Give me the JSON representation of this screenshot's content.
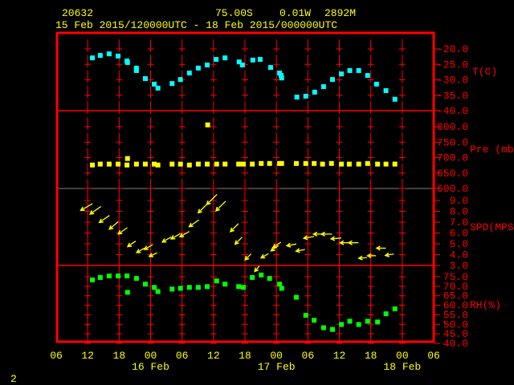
{
  "header": {
    "station": "20632",
    "lat": "75.00S",
    "lon": "0.01W",
    "elev": "2892M",
    "period": "15 Feb 2015/120000UTC - 18 Feb 2015/000000UTC"
  },
  "footer": {
    "page": "2"
  },
  "colors": {
    "frame": "#ff0000",
    "text": "#ffff00",
    "temp": "#00ffff",
    "pres": "#ffff00",
    "wind": "#ffff00",
    "rh": "#00ff00",
    "separator": "#808080"
  },
  "chart_data": {
    "type": "scatter",
    "title": "20632  75.00S  0.01W  2892M",
    "subtitle": "15 Feb 2015/120000UTC - 18 Feb 2015/000000UTC",
    "x_unit": "hours since 15 Feb 2015 06UTC",
    "x_range": [
      0,
      72
    ],
    "x_tick_hours": [
      0,
      6,
      12,
      18,
      24,
      30,
      36,
      42,
      48,
      54,
      60,
      66,
      72
    ],
    "x_tick_labels": [
      "06",
      "12",
      "18",
      "00",
      "06",
      "12",
      "18",
      "00",
      "06",
      "12",
      "18",
      "00",
      "06"
    ],
    "date_labels": [
      {
        "hour": 18,
        "label": "16 Feb"
      },
      {
        "hour": 42,
        "label": "17 Feb"
      },
      {
        "hour": 66,
        "label": "18 Feb"
      }
    ],
    "panels": [
      {
        "name": "T(C)",
        "ylim": [
          -40,
          -20
        ],
        "ticks": [
          -20,
          -25,
          -30,
          -35,
          -40
        ],
        "tick_labels": [
          "-20.0",
          "-25.0",
          "-30.0",
          "-35.0",
          "-40.0"
        ],
        "series_color": "#00ffff",
        "points": [
          [
            6.9,
            -22.9
          ],
          [
            8.4,
            -22.1
          ],
          [
            10.1,
            -21.6
          ],
          [
            11.8,
            -22.3
          ],
          [
            13.5,
            -23.9
          ],
          [
            13.6,
            -24.4
          ],
          [
            15.3,
            -26.2
          ],
          [
            15.3,
            -27.0
          ],
          [
            17.0,
            -29.6
          ],
          [
            18.7,
            -31.4
          ],
          [
            19.4,
            -32.7
          ],
          [
            22.1,
            -31.2
          ],
          [
            23.7,
            -29.9
          ],
          [
            25.4,
            -27.8
          ],
          [
            27.1,
            -26.2
          ],
          [
            28.8,
            -25.2
          ],
          [
            30.5,
            -23.4
          ],
          [
            32.2,
            -22.9
          ],
          [
            34.9,
            -24.2
          ],
          [
            35.5,
            -25.2
          ],
          [
            37.5,
            -23.6
          ],
          [
            38.9,
            -23.4
          ],
          [
            40.9,
            -26.0
          ],
          [
            42.6,
            -27.8
          ],
          [
            42.9,
            -28.6
          ],
          [
            43.0,
            -29.4
          ],
          [
            45.9,
            -35.6
          ],
          [
            47.6,
            -35.3
          ],
          [
            49.3,
            -34.0
          ],
          [
            51.0,
            -32.2
          ],
          [
            52.7,
            -29.9
          ],
          [
            54.4,
            -28.1
          ],
          [
            56.0,
            -27.0
          ],
          [
            57.7,
            -27.0
          ],
          [
            59.4,
            -28.6
          ],
          [
            61.1,
            -31.4
          ],
          [
            62.9,
            -33.5
          ],
          [
            64.6,
            -36.3
          ]
        ]
      },
      {
        "name": "Pre (mb)",
        "ylim": [
          600,
          800
        ],
        "ticks": [
          800,
          750,
          700,
          650,
          600
        ],
        "tick_labels": [
          "800.0",
          "750.0",
          "700.0",
          "650.0",
          "600.0"
        ],
        "series_color": "#ffff00",
        "points": [
          [
            6.9,
            676
          ],
          [
            8.4,
            679
          ],
          [
            10.1,
            679
          ],
          [
            11.8,
            679
          ],
          [
            13.5,
            676
          ],
          [
            13.6,
            697
          ],
          [
            15.3,
            679
          ],
          [
            17.0,
            679
          ],
          [
            18.7,
            679
          ],
          [
            19.4,
            676
          ],
          [
            22.1,
            679
          ],
          [
            23.7,
            679
          ],
          [
            25.4,
            676
          ],
          [
            27.1,
            679
          ],
          [
            28.8,
            679
          ],
          [
            28.9,
            806
          ],
          [
            30.6,
            679
          ],
          [
            32.2,
            679
          ],
          [
            34.8,
            679
          ],
          [
            35.7,
            679
          ],
          [
            37.4,
            679
          ],
          [
            39.1,
            681
          ],
          [
            40.7,
            681
          ],
          [
            42.6,
            681
          ],
          [
            43.0,
            681
          ],
          [
            45.8,
            681
          ],
          [
            47.6,
            681
          ],
          [
            49.2,
            681
          ],
          [
            50.8,
            679
          ],
          [
            52.5,
            681
          ],
          [
            54.4,
            679
          ],
          [
            55.9,
            679
          ],
          [
            57.7,
            679
          ],
          [
            59.4,
            681
          ],
          [
            61.3,
            679
          ],
          [
            62.9,
            679
          ],
          [
            64.6,
            679
          ]
        ]
      },
      {
        "name": "SPD(MPS)",
        "ylim": [
          3,
          9
        ],
        "ticks": [
          9,
          8,
          7,
          6,
          5,
          4,
          3
        ],
        "tick_labels": [
          "9.0",
          "8.0",
          "7.0",
          "6.0",
          "5.0",
          "4.0",
          "3.0"
        ],
        "series_color": "#ffff00",
        "wind_points_hour_speed_dirfrom": [
          [
            5.8,
            8.4,
            60
          ],
          [
            7.5,
            8.1,
            55
          ],
          [
            9.2,
            7.3,
            55
          ],
          [
            11.0,
            6.7,
            50
          ],
          [
            12.7,
            6.2,
            55
          ],
          [
            14.4,
            5.0,
            55
          ],
          [
            16.1,
            4.4,
            60
          ],
          [
            17.6,
            4.7,
            60
          ],
          [
            18.5,
            4.0,
            65
          ],
          [
            21.1,
            5.4,
            60
          ],
          [
            22.8,
            5.7,
            60
          ],
          [
            24.5,
            5.9,
            60
          ],
          [
            26.3,
            6.9,
            55
          ],
          [
            28.0,
            8.3,
            45
          ],
          [
            29.7,
            9.1,
            45
          ],
          [
            31.4,
            8.5,
            45
          ],
          [
            34.0,
            6.5,
            45
          ],
          [
            34.8,
            5.3,
            45
          ],
          [
            36.6,
            3.8,
            45
          ],
          [
            38.3,
            2.7,
            40
          ],
          [
            39.8,
            3.9,
            60
          ],
          [
            41.7,
            4.6,
            55
          ],
          [
            42.1,
            4.9,
            55
          ],
          [
            44.9,
            4.9,
            80
          ],
          [
            46.6,
            4.4,
            80
          ],
          [
            48.2,
            5.6,
            80
          ],
          [
            50.1,
            5.9,
            90
          ],
          [
            51.6,
            5.9,
            90
          ],
          [
            53.4,
            5.5,
            85
          ],
          [
            55.1,
            5.1,
            90
          ],
          [
            56.7,
            5.1,
            90
          ],
          [
            58.5,
            3.7,
            85
          ],
          [
            60.2,
            3.9,
            90
          ],
          [
            62.0,
            4.6,
            90
          ],
          [
            63.6,
            4.0,
            80
          ]
        ]
      },
      {
        "name": "RH(%)",
        "ylim": [
          40,
          75
        ],
        "ticks": [
          75,
          70,
          65,
          60,
          55,
          50,
          45,
          40
        ],
        "tick_labels": [
          "75.0",
          "70.0",
          "65.0",
          "60.0",
          "55.0",
          "50.0",
          "45.0",
          "40.0"
        ],
        "series_color": "#00ff00",
        "points": [
          [
            6.9,
            73.3
          ],
          [
            8.4,
            74.6
          ],
          [
            10.1,
            75.4
          ],
          [
            11.8,
            75.4
          ],
          [
            13.5,
            75.4
          ],
          [
            13.6,
            66.8
          ],
          [
            15.3,
            74.1
          ],
          [
            17.0,
            71.1
          ],
          [
            18.7,
            69.4
          ],
          [
            19.4,
            67.2
          ],
          [
            22.1,
            68.5
          ],
          [
            23.7,
            68.9
          ],
          [
            25.4,
            69.4
          ],
          [
            27.1,
            69.4
          ],
          [
            28.8,
            69.8
          ],
          [
            30.6,
            72.8
          ],
          [
            32.2,
            71.1
          ],
          [
            34.8,
            69.8
          ],
          [
            35.7,
            69.4
          ],
          [
            37.4,
            74.6
          ],
          [
            39.1,
            75.9
          ],
          [
            40.7,
            74.1
          ],
          [
            42.6,
            71.1
          ],
          [
            43.0,
            68.9
          ],
          [
            45.8,
            64.2
          ],
          [
            47.6,
            54.7
          ],
          [
            49.2,
            52.1
          ],
          [
            51.0,
            48.2
          ],
          [
            52.7,
            47.3
          ],
          [
            54.4,
            49.9
          ],
          [
            56.0,
            51.6
          ],
          [
            57.7,
            49.9
          ],
          [
            59.4,
            51.6
          ],
          [
            61.3,
            51.2
          ],
          [
            62.9,
            55.5
          ],
          [
            64.6,
            58.1
          ]
        ]
      }
    ]
  }
}
